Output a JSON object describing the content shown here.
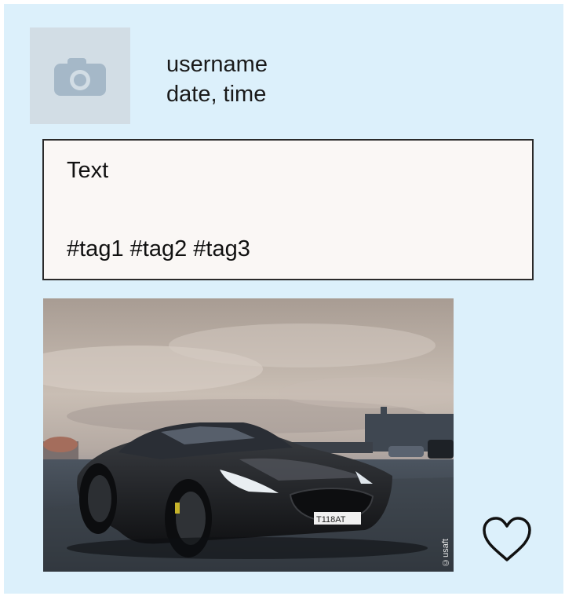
{
  "post": {
    "username": "username",
    "datetime": "date, time",
    "text": "Text",
    "tags": "#tag1 #tag2 #tag3",
    "plate": "Т118АТ",
    "watermark": "©usaft"
  },
  "icons": {
    "avatar": "camera-icon",
    "like": "heart-outline-icon"
  },
  "colors": {
    "card_background": "#dcf0fb",
    "avatar_placeholder": "#d2dde5",
    "camera_icon": "#a5b8c8",
    "text_box_background": "#faf7f5"
  }
}
